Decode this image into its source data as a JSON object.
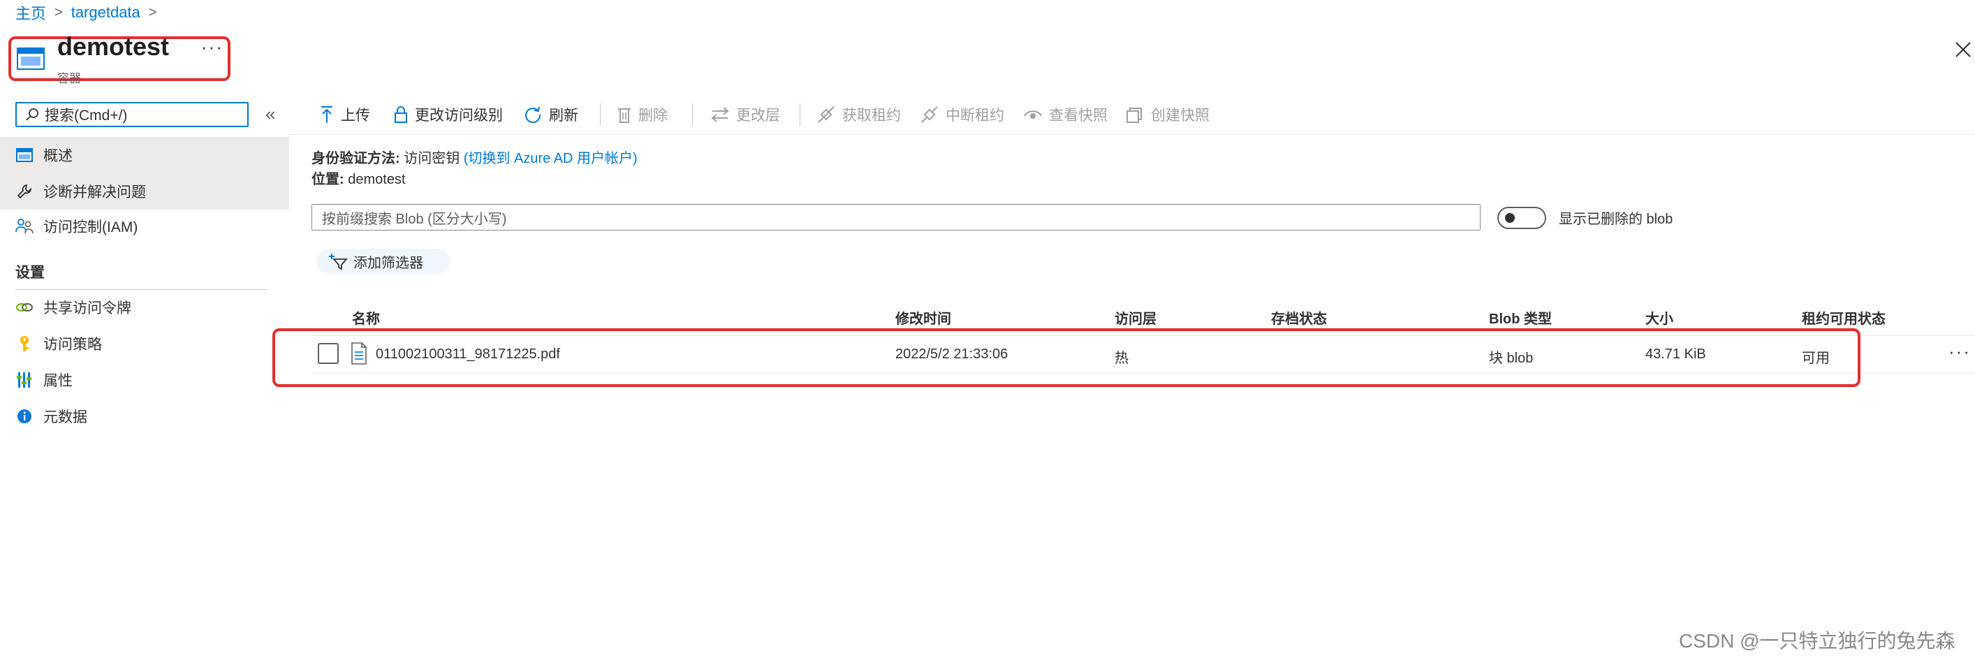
{
  "breadcrumb": {
    "home": "主页",
    "item": "targetdata"
  },
  "header": {
    "title": "demotest",
    "subtitle": "容器",
    "more": "···"
  },
  "sidebar": {
    "search_placeholder": "搜索(Cmd+/)",
    "collapse": "«",
    "items": [
      {
        "label": "概述",
        "icon": "overview-icon"
      },
      {
        "label": "诊断并解决问题",
        "icon": "wrench-icon"
      },
      {
        "label": "访问控制(IAM)",
        "icon": "people-icon"
      }
    ],
    "settings_title": "设置",
    "settings_items": [
      {
        "label": "共享访问令牌",
        "icon": "link-icon"
      },
      {
        "label": "访问策略",
        "icon": "key-icon"
      },
      {
        "label": "属性",
        "icon": "properties-icon"
      },
      {
        "label": "元数据",
        "icon": "info-icon"
      }
    ]
  },
  "toolbar": {
    "upload": "上传",
    "change_access": "更改访问级别",
    "refresh": "刷新",
    "delete": "删除",
    "change_tier": "更改层",
    "acquire_lease": "获取租约",
    "break_lease": "中断租约",
    "view_snapshots": "查看快照",
    "create_snapshot": "创建快照"
  },
  "auth": {
    "label": "身份验证方法:",
    "method": "访问密钥",
    "switch_link": "(切换到 Azure AD 用户帐户)",
    "location_label": "位置:",
    "location": "demotest"
  },
  "filter": {
    "search_placeholder": "按前缀搜索 Blob (区分大小写)",
    "show_deleted": "显示已删除的 blob",
    "show_deleted_on": false,
    "add_filter": "添加筛选器"
  },
  "table": {
    "columns": [
      "名称",
      "修改时间",
      "访问层",
      "存档状态",
      "Blob 类型",
      "大小",
      "租约可用状态"
    ],
    "rows": [
      {
        "name": "011002100311_98171225.pdf",
        "modified": "2022/5/2 21:33:06",
        "tier": "热",
        "archive": "",
        "type": "块 blob",
        "size": "43.71 KiB",
        "lease": "可用"
      }
    ],
    "row_more": "···"
  },
  "watermark": "CSDN @一只特立独行的兔先森",
  "colors": {
    "accent": "#0078d4",
    "highlight": "#e0302c",
    "disabled": "#a19f9d"
  }
}
